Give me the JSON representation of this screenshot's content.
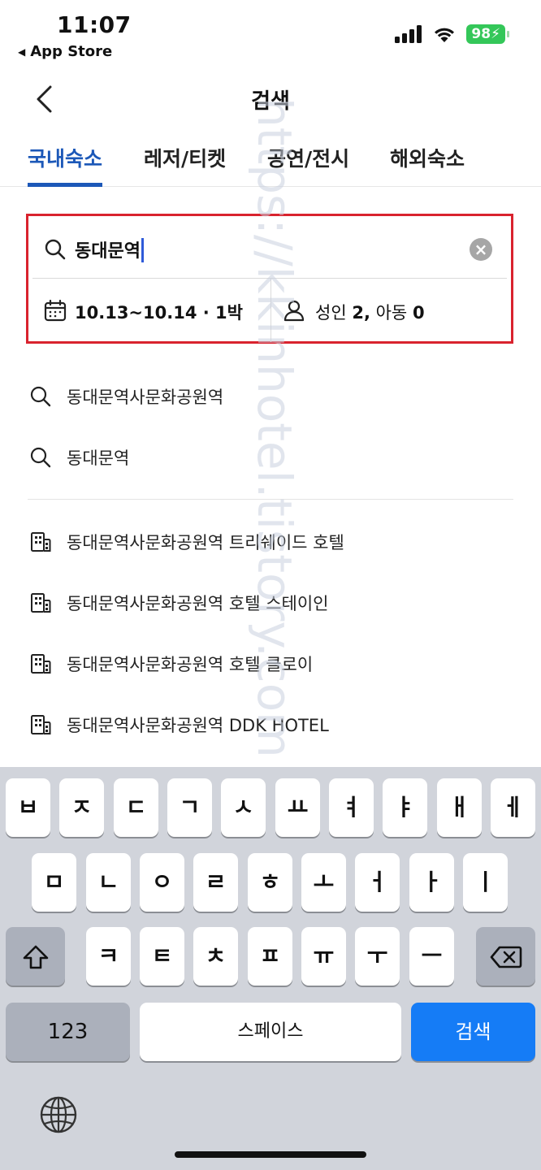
{
  "status_bar": {
    "time": "11:07",
    "back_app": "App Store",
    "battery": "98"
  },
  "header": {
    "title": "검색"
  },
  "tabs": [
    {
      "label": "국내숙소",
      "active": true
    },
    {
      "label": "레저/티켓",
      "active": false
    },
    {
      "label": "공연/전시",
      "active": false
    },
    {
      "label": "해외숙소",
      "active": false
    }
  ],
  "search": {
    "value": "동대문역",
    "dates": "10.13~10.14 · 1박",
    "guests_adult_label": "성인",
    "guests_adult_count": "2,",
    "guests_child_label": "아동",
    "guests_child_count": "0"
  },
  "keyword_suggestions": [
    "동대문역사문화공원역",
    "동대문역"
  ],
  "hotel_suggestions": [
    "동대문역사문화공원역 트리쉐이드 호텔",
    "동대문역사문화공원역 호텔 스테이인",
    "동대문역사문화공원역 호텔 클로이",
    "동대문역사문화공원역 DDK HOTEL"
  ],
  "watermark": "https://kkinhotel.tistory.com",
  "keyboard": {
    "row1": [
      "ㅂ",
      "ㅈ",
      "ㄷ",
      "ㄱ",
      "ㅅ",
      "ㅛ",
      "ㅕ",
      "ㅑ",
      "ㅐ",
      "ㅔ"
    ],
    "row2": [
      "ㅁ",
      "ㄴ",
      "ㅇ",
      "ㄹ",
      "ㅎ",
      "ㅗ",
      "ㅓ",
      "ㅏ",
      "ㅣ"
    ],
    "row3": [
      "ㅋ",
      "ㅌ",
      "ㅊ",
      "ㅍ",
      "ㅠ",
      "ㅜ",
      "ㅡ"
    ],
    "num_key": "123",
    "space_key": "스페이스",
    "search_key": "검색"
  }
}
